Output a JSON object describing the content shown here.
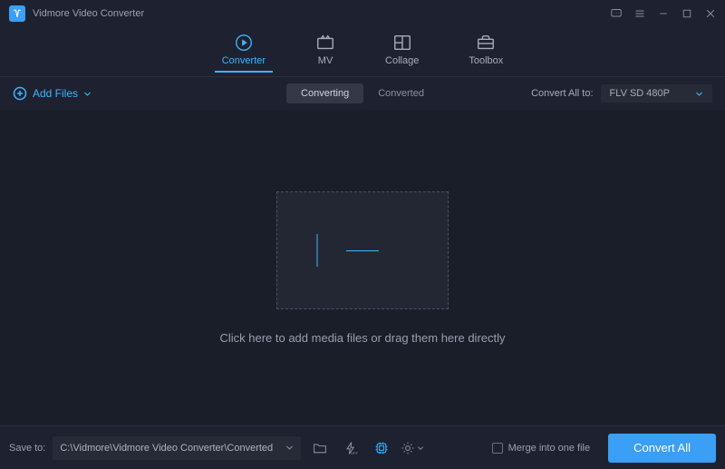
{
  "titlebar": {
    "app_name": "Vidmore Video Converter"
  },
  "nav": {
    "tabs": [
      {
        "label": "Converter",
        "icon": "converter",
        "active": true
      },
      {
        "label": "MV",
        "icon": "mv",
        "active": false
      },
      {
        "label": "Collage",
        "icon": "collage",
        "active": false
      },
      {
        "label": "Toolbox",
        "icon": "toolbox",
        "active": false
      }
    ]
  },
  "subbar": {
    "add_files_label": "Add Files",
    "pills": {
      "converting": "Converting",
      "converted": "Converted"
    },
    "convert_all_to_label": "Convert All to:",
    "format_selected": "FLV SD 480P"
  },
  "main": {
    "drop_hint": "Click here to add media files or drag them here directly"
  },
  "bottom": {
    "save_to_label": "Save to:",
    "save_path": "C:\\Vidmore\\Vidmore Video Converter\\Converted",
    "merge_label": "Merge into one file",
    "convert_all_btn": "Convert All"
  },
  "colors": {
    "accent": "#3fb4ff",
    "primary_button": "#3a9ff5"
  }
}
